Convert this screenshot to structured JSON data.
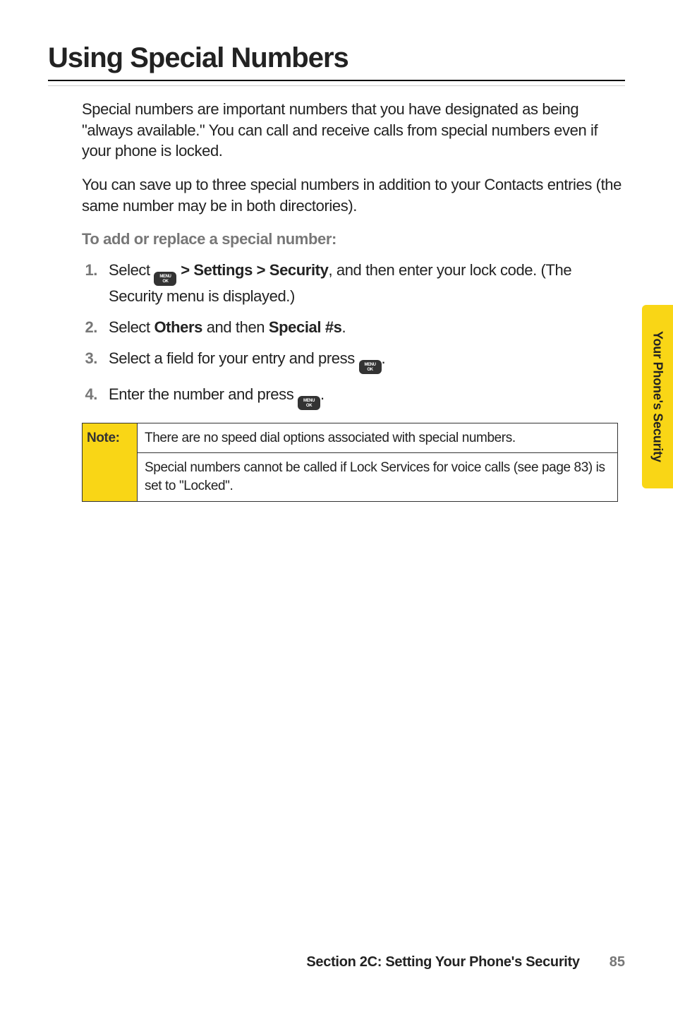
{
  "title": "Using Special Numbers",
  "paragraphs": {
    "p1": "Special numbers are important numbers that you have designated as being \"always available.\" You can call and receive calls from special numbers even if your phone is locked.",
    "p2": "You can save up to three special numbers in addition to your Contacts entries (the same number may be in both directories).",
    "subhead": "To add or replace a special number:"
  },
  "icon": {
    "top": "MENU",
    "bottom": "OK"
  },
  "steps": {
    "s1": {
      "num": "1.",
      "prefix": "Select ",
      "bold": " > Settings > Security",
      "suffix": ", and then enter your lock code. (The Security menu is displayed.)"
    },
    "s2": {
      "num": "2.",
      "p1": "Select ",
      "b1": "Others",
      "p2": " and then ",
      "b2": "Special #s",
      "p3": "."
    },
    "s3": {
      "num": "3.",
      "text": "Select a field for your entry and press ",
      "tail": "."
    },
    "s4": {
      "num": "4.",
      "text": "Enter the number and press ",
      "tail": "."
    }
  },
  "note": {
    "label": "Note:",
    "row1": "There are no speed dial options associated with special numbers.",
    "row2": "Special numbers cannot be called if Lock Services for voice calls (see page 83) is set to \"Locked\"."
  },
  "sideTab": "Your Phone's Security",
  "footer": {
    "text": "Section 2C: Setting Your Phone's Security",
    "page": "85"
  }
}
